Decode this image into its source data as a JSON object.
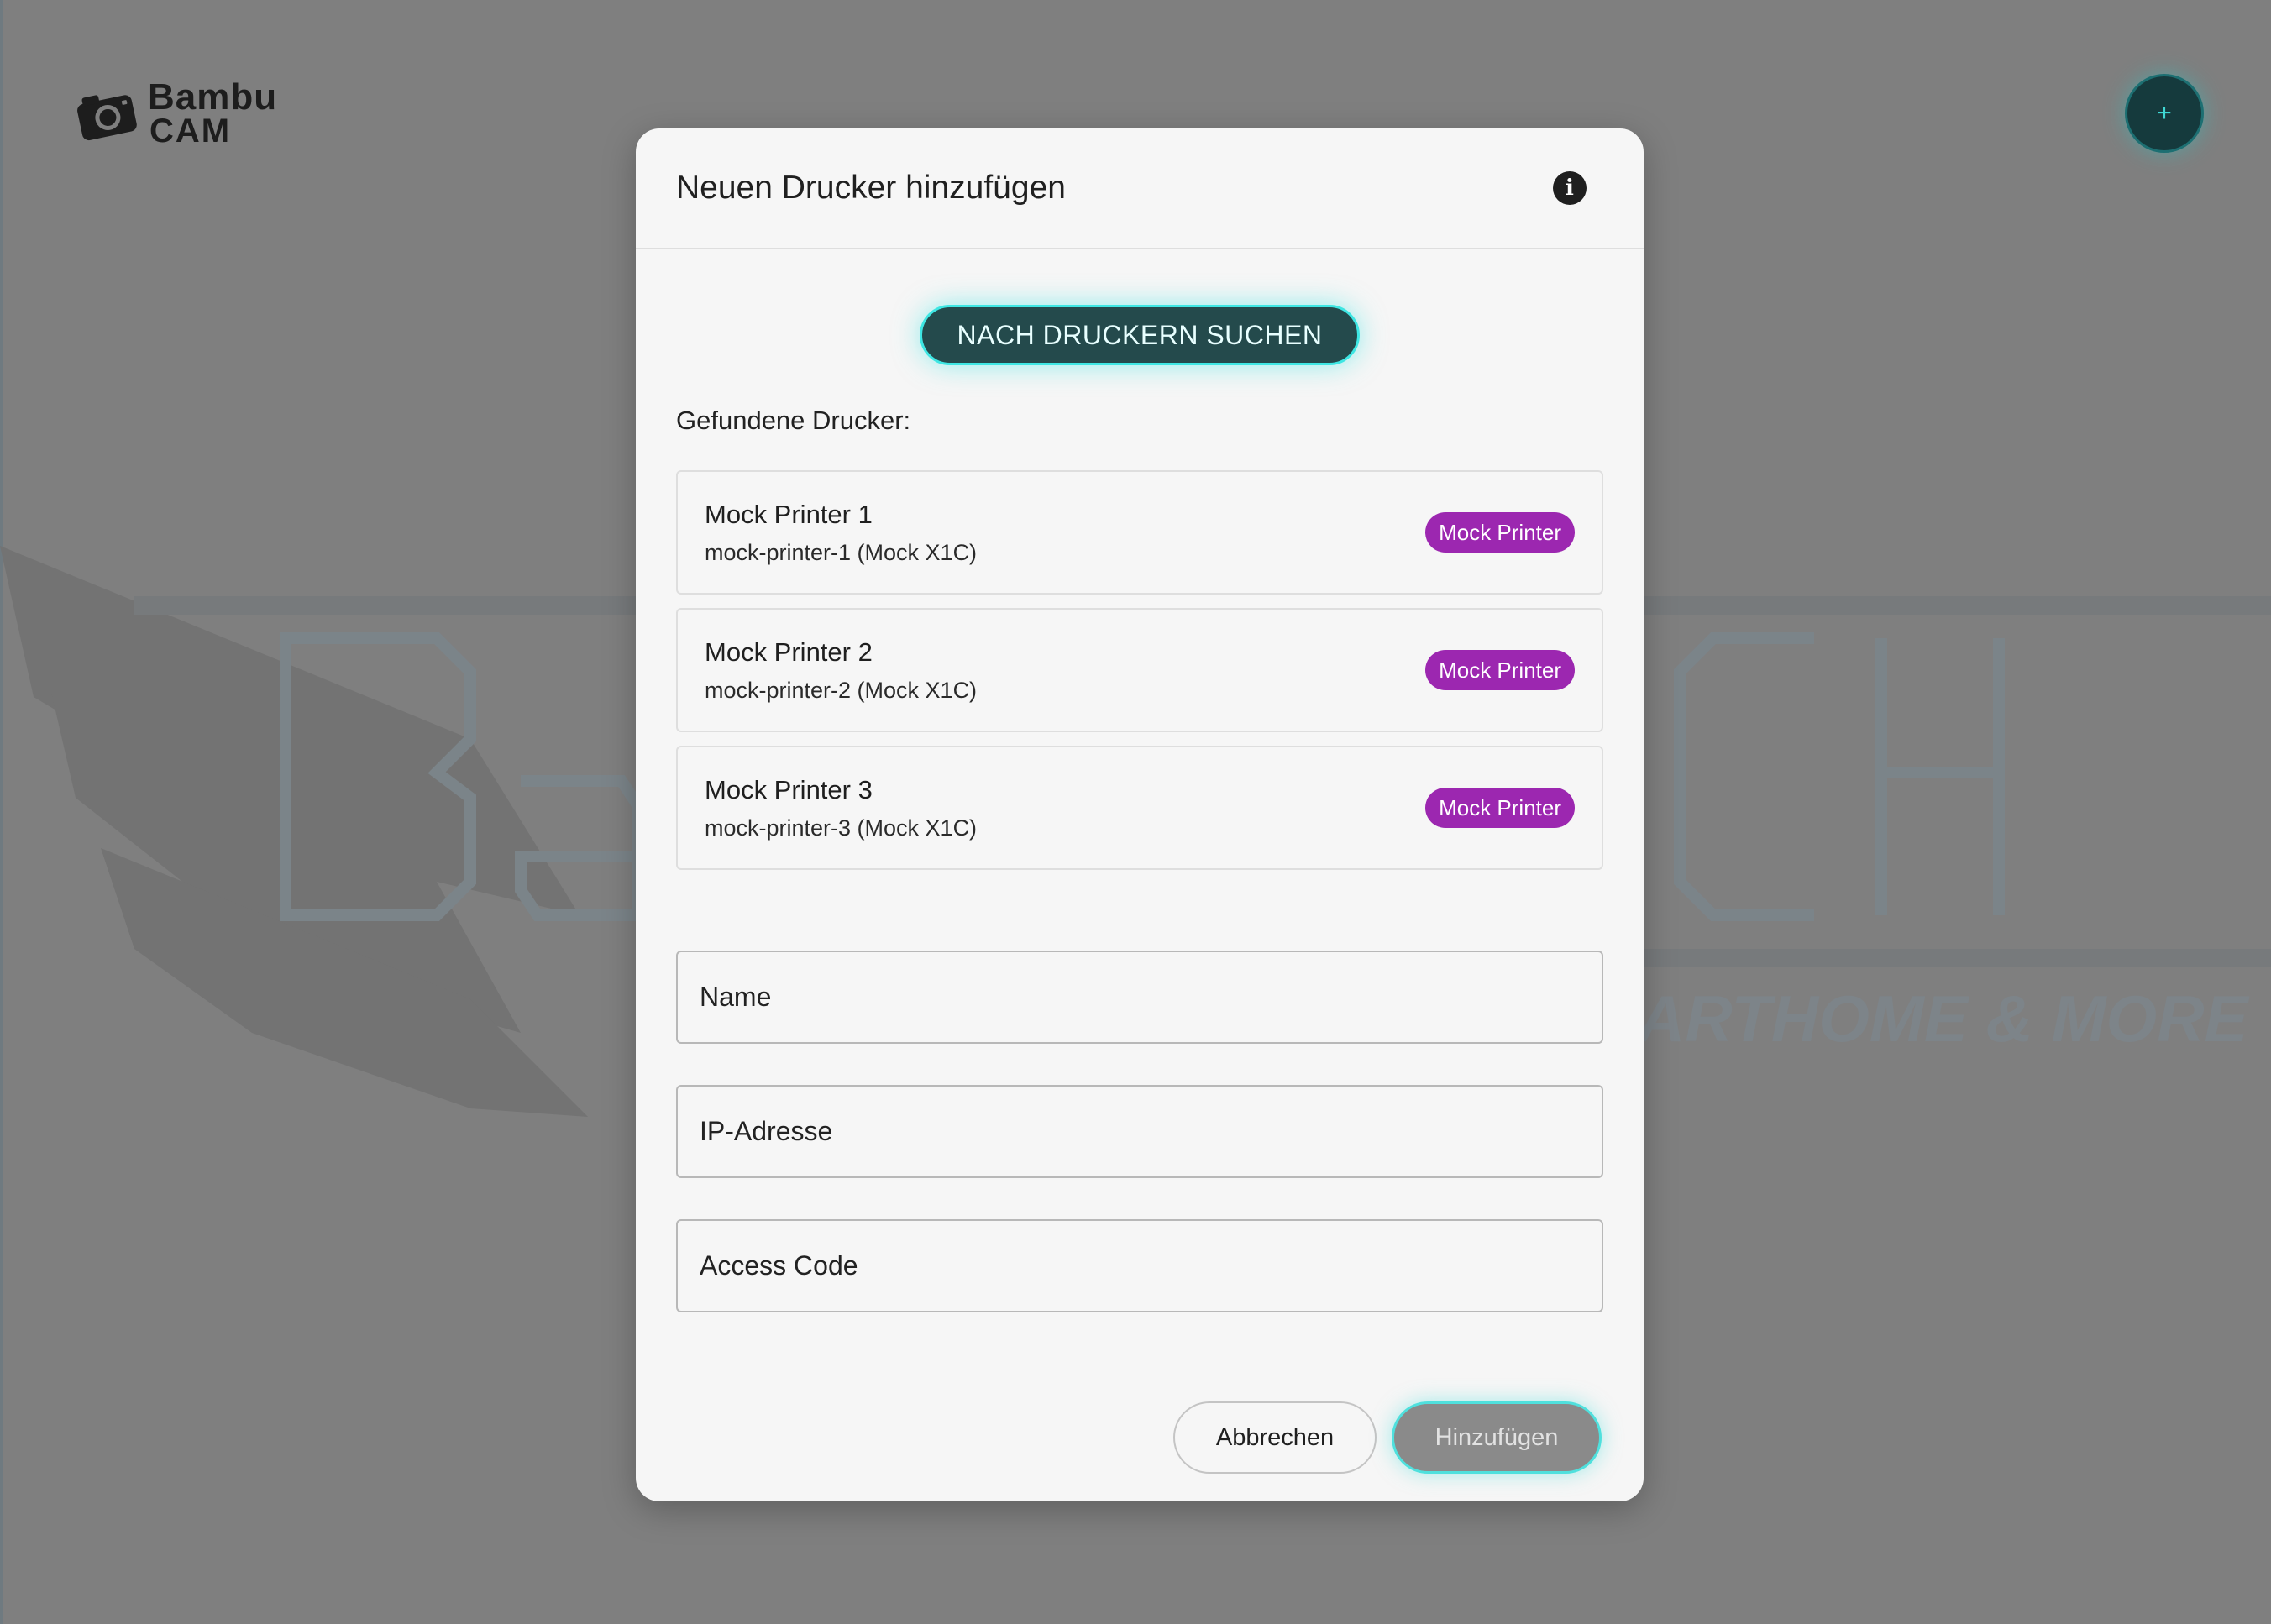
{
  "app": {
    "brand_line1": "Bambu",
    "brand_line2": "CAM",
    "fab_icon": "plus-icon",
    "fab_label": "+"
  },
  "watermark": {
    "text_left": "Ba",
    "text_right": "ECH",
    "tagline": "ARTHOME & MORE"
  },
  "dialog": {
    "title": "Neuen Drucker hinzufügen",
    "info_icon": "info-icon",
    "info_glyph": "i",
    "scan_button_label": "NACH DRUCKERN SUCHEN",
    "found_label": "Gefundene Drucker:",
    "printers": [
      {
        "name": "Mock Printer 1",
        "sub": "mock-printer-1 (Mock X1C)",
        "badge": "Mock Printer"
      },
      {
        "name": "Mock Printer 2",
        "sub": "mock-printer-2 (Mock X1C)",
        "badge": "Mock Printer"
      },
      {
        "name": "Mock Printer 3",
        "sub": "mock-printer-3 (Mock X1C)",
        "badge": "Mock Printer"
      }
    ],
    "fields": {
      "name_placeholder": "Name",
      "ip_placeholder": "IP-Adresse",
      "access_placeholder": "Access Code"
    },
    "cancel_label": "Abbrechen",
    "add_label": "Hinzufügen"
  },
  "colors": {
    "accent_cyan": "#3ee6e3",
    "badge_purple": "#9c27b0",
    "scan_button_bg": "#244a4c"
  }
}
